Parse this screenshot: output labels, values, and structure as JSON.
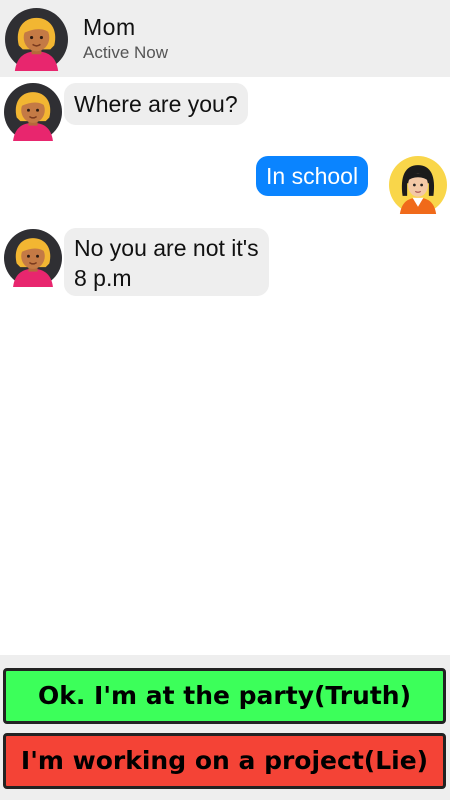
{
  "header": {
    "name": "Mom",
    "status": "Active Now",
    "avatar_icon": "mom-avatar-icon"
  },
  "messages": [
    {
      "from": "Mom",
      "text": "Where are you?"
    },
    {
      "from": "me",
      "text": "In school"
    },
    {
      "from": "Mom",
      "text_line1": "No you are not it's",
      "text_line2": "8 p.m"
    }
  ],
  "choices": {
    "truth": "Ok. I'm at the party(Truth)",
    "lie": "I'm working on a project(Lie)"
  },
  "colors": {
    "sent_bubble": "#0a84ff",
    "received_bubble": "#eeeeee",
    "truth_button": "#3cff5a",
    "lie_button": "#f44336"
  }
}
